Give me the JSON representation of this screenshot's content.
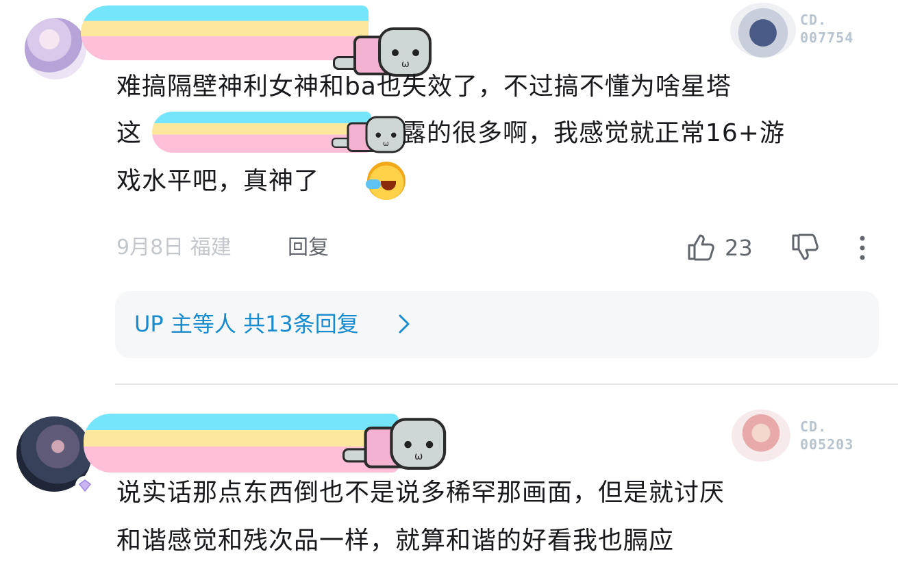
{
  "comments": [
    {
      "lines": [
        "难搞隔壁神利女神和ba也失效了，不过搞不懂为啥星塔",
        "这",
        "露的很多啊，我感觉就正常16+游",
        "戏水平吧，真神了"
      ],
      "date_location": "9月8日 福建",
      "reply_label": "回复",
      "like_count": "23",
      "decoration_number": [
        "CD.",
        "007754"
      ],
      "replies_summary": "UP 主等人 共13条回复"
    },
    {
      "lines": [
        "说实话那点东西倒也不是说多稀罕那画面，但是就讨厌",
        "和谐感觉和残次品一样，就算和谐的好看我也膈应"
      ],
      "decoration_number": [
        "CD.",
        "005203"
      ]
    }
  ],
  "colors": {
    "text": "#18191c",
    "meta": "#c3c7cc",
    "accent_link": "#178bcf",
    "reply_box_bg": "#f6f7f8"
  },
  "icons": [
    "thumbs-up-icon",
    "thumbs-down-icon",
    "more-vertical-icon",
    "chevron-right-icon",
    "nyan-cat-sticker",
    "laugh-cry-emoji"
  ]
}
